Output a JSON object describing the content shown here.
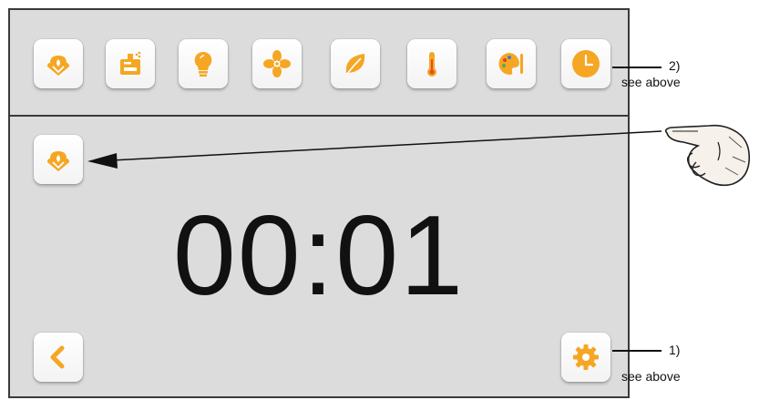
{
  "colors": {
    "accent": "#f5a623",
    "accent_light": "#ffd24d",
    "panel": "#dcdcdc",
    "border": "#3a3a3a"
  },
  "toolbar": {
    "buttons": [
      {
        "icon": "steam-cloud-icon"
      },
      {
        "icon": "heater-icon"
      },
      {
        "icon": "light-bulb-icon"
      },
      {
        "icon": "fan-icon"
      },
      {
        "icon": "leaf-icon"
      },
      {
        "icon": "thermometer-icon"
      },
      {
        "icon": "palette-icon"
      },
      {
        "icon": "clock-icon"
      }
    ]
  },
  "main": {
    "mode_icon": "steam-cloud-icon",
    "timer_value": "00:01",
    "back_icon": "chevron-left-icon",
    "settings_icon": "gear-icon"
  },
  "annotations": {
    "callout_2": {
      "number": "2)",
      "text": "see above"
    },
    "callout_1": {
      "number": "1)",
      "text": "see above"
    },
    "hand_icon": "pointing-hand-icon"
  }
}
